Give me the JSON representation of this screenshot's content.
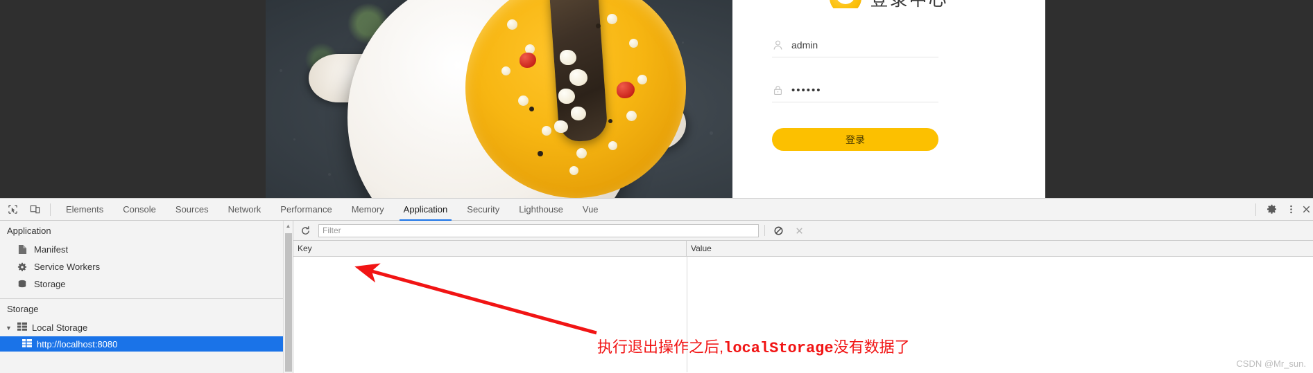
{
  "page": {
    "login": {
      "logo_title": "登录中心",
      "username_value": "admin",
      "username_icon": "user-icon",
      "password_value": "••••••",
      "password_icon": "lock-icon",
      "submit_label": "登录",
      "accent_color": "#fcc000"
    }
  },
  "devtools": {
    "toolbar": {
      "inspect_icon": "inspect-element-icon",
      "device_icon": "device-toolbar-icon",
      "settings_icon": "gear-icon",
      "more_icon": "more-vertical-icon",
      "close_icon": "close-icon"
    },
    "tabs": [
      {
        "label": "Elements",
        "active": false
      },
      {
        "label": "Console",
        "active": false
      },
      {
        "label": "Sources",
        "active": false
      },
      {
        "label": "Network",
        "active": false
      },
      {
        "label": "Performance",
        "active": false
      },
      {
        "label": "Memory",
        "active": false
      },
      {
        "label": "Application",
        "active": true
      },
      {
        "label": "Security",
        "active": false
      },
      {
        "label": "Lighthouse",
        "active": false
      },
      {
        "label": "Vue",
        "active": false
      }
    ],
    "active_tab": "Application",
    "sidebar": {
      "application_header": "Application",
      "application_items": [
        {
          "label": "Manifest",
          "icon": "document-icon"
        },
        {
          "label": "Service Workers",
          "icon": "gear-icon"
        },
        {
          "label": "Storage",
          "icon": "database-icon"
        }
      ],
      "storage_header": "Storage",
      "tree": [
        {
          "label": "Local Storage",
          "icon": "storage-table-icon",
          "expanded": true,
          "caret": "▼",
          "children": [
            {
              "label": "http://localhost:8080",
              "icon": "storage-table-icon",
              "selected": true
            }
          ]
        }
      ]
    },
    "filterbar": {
      "refresh_icon": "refresh-icon",
      "filter_placeholder": "Filter",
      "filter_value": "",
      "clear_all_icon": "clear-all-icon",
      "delete_icon": "delete-selected-icon"
    },
    "table": {
      "columns": [
        "Key",
        "Value"
      ],
      "rows": []
    }
  },
  "annotation": {
    "text_prefix": "执行退出操作之后,",
    "text_mono": "localStorage",
    "text_suffix": "没有数据了",
    "color": "#f11414",
    "arrow": "red-arrow"
  },
  "watermark": "CSDN @Mr_sun."
}
